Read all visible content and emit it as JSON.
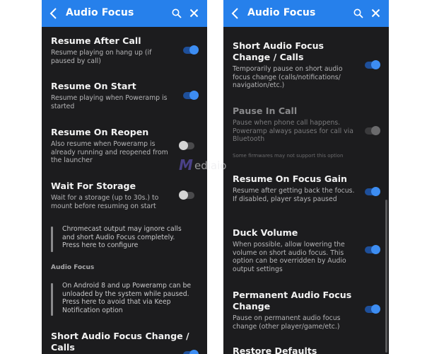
{
  "colors": {
    "accent": "#2680eb",
    "panel_bg": "#1c1c1e",
    "toggle_on": "#3d8df2"
  },
  "left": {
    "title": "Audio Focus",
    "items": [
      {
        "title": "Resume After Call",
        "subtitle": "Resume playing on hang up (if paused by call)",
        "state": "on"
      },
      {
        "title": "Resume On Start",
        "subtitle": "Resume playing when Poweramp is started",
        "state": "on"
      },
      {
        "title": "Resume On Reopen",
        "subtitle": "Also resume when Poweramp is already running and reopened from the launcher",
        "state": "off"
      },
      {
        "title": "Wait For Storage",
        "subtitle": "Wait for a storage (up to 30s.) to mount before resuming on start",
        "state": "off"
      }
    ],
    "note1": "Chromecast output may ignore calls and short Audio Focus completely. Press here to configure",
    "section": "Audio Focus",
    "note2": "On Android 8 and up Poweramp can be unloaded by the system while paused. Press here to avoid that via Keep Notification option",
    "last_item": {
      "title": "Short Audio Focus Change / Calls",
      "state": "on"
    }
  },
  "right": {
    "title": "Audio Focus",
    "items": [
      {
        "title": "Short Audio Focus Change / Calls",
        "subtitle": "Temporarily pause on short audio focus change (calls/notifications/ navigation/etc.)",
        "state": "on"
      },
      {
        "title": "Pause In Call",
        "subtitle": "Pause when phone call happens. Poweramp always pauses for call via Bluetooth",
        "state": "disabled"
      },
      {
        "title": "Resume On Focus Gain",
        "subtitle": "Resume after getting back the focus. If disabled, player stays paused",
        "state": "on"
      },
      {
        "title": "Duck Volume",
        "subtitle": "When possible, allow lowering the volume on short audio focus. This option can be overridden by Audio output settings",
        "state": "on"
      },
      {
        "title": "Permanent Audio Focus Change",
        "subtitle": "Pause on permanent audio focus change (other player/game/etc.)",
        "state": "on"
      }
    ],
    "firmware_note": "Some firmwares may not support this option",
    "last_item": {
      "title": "Restore Defaults"
    }
  },
  "watermark": {
    "logo": "M",
    "text": "ediaio"
  }
}
